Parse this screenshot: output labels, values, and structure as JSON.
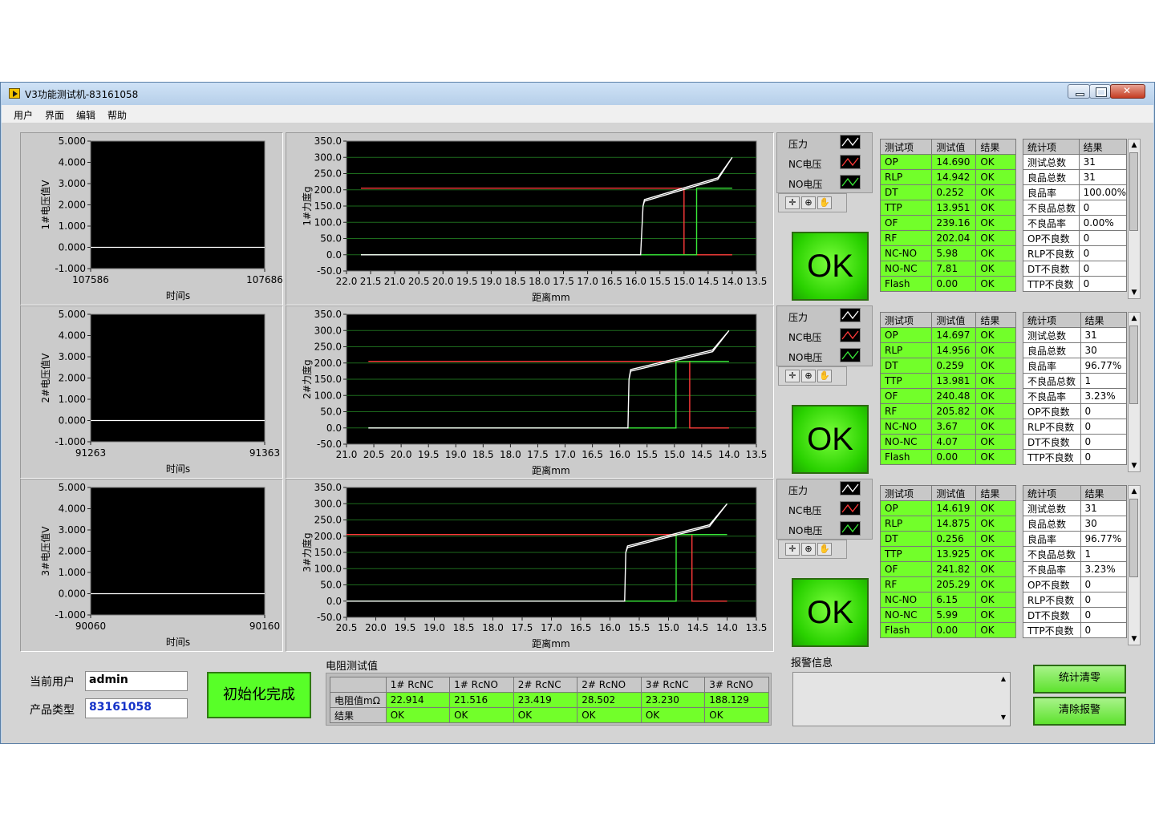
{
  "window": {
    "title": "V3功能测试机-83161058"
  },
  "menu": [
    "用户",
    "界面",
    "编辑",
    "帮助"
  ],
  "colors": {
    "ok_green": "#72ff2a",
    "force_white": "#ffffff",
    "nc_red": "#ff3a3a",
    "no_green": "#38e838"
  },
  "stations": [
    {
      "voltage_chart": {
        "ylabel": "1#电压值V",
        "xlabel": "时间s",
        "yticks": [
          "5.000",
          "4.000",
          "3.000",
          "2.000",
          "1.000",
          "0.000",
          "-1.000"
        ],
        "xticks": [
          "107586",
          "107686"
        ]
      },
      "force_chart": {
        "ylabel": "1#力度g",
        "xlabel": "距离mm",
        "yticks": [
          "350.0",
          "300.0",
          "250.0",
          "200.0",
          "150.0",
          "100.0",
          "50.0",
          "0.0",
          "-50.0"
        ],
        "xticks": [
          "22.0",
          "21.5",
          "21.0",
          "20.5",
          "20.0",
          "19.5",
          "19.0",
          "18.5",
          "18.0",
          "17.5",
          "17.0",
          "16.5",
          "16.0",
          "15.5",
          "15.0",
          "14.5",
          "14.0",
          "13.5"
        ]
      },
      "legend": [
        "压力",
        "NC电压",
        "NO电压"
      ],
      "result": "OK",
      "test_table": {
        "headers": [
          "测试项",
          "测试值",
          "结果"
        ],
        "rows": [
          [
            "OP",
            "14.690",
            "OK"
          ],
          [
            "RLP",
            "14.942",
            "OK"
          ],
          [
            "DT",
            "0.252",
            "OK"
          ],
          [
            "TTP",
            "13.951",
            "OK"
          ],
          [
            "OF",
            "239.16",
            "OK"
          ],
          [
            "RF",
            "202.04",
            "OK"
          ],
          [
            "NC-NO",
            "5.98",
            "OK"
          ],
          [
            "NO-NC",
            "7.81",
            "OK"
          ],
          [
            "Flash",
            "0.00",
            "OK"
          ]
        ]
      },
      "stat_table": {
        "headers": [
          "统计项",
          "结果"
        ],
        "rows": [
          [
            "测试总数",
            "31"
          ],
          [
            "良品总数",
            "31"
          ],
          [
            "良品率",
            "100.00%"
          ],
          [
            "不良品总数",
            "0"
          ],
          [
            "不良品率",
            "0.00%"
          ],
          [
            "OP不良数",
            "0"
          ],
          [
            "RLP不良数",
            "0"
          ],
          [
            "DT不良数",
            "0"
          ],
          [
            "TTP不良数",
            "0"
          ]
        ]
      }
    },
    {
      "voltage_chart": {
        "ylabel": "2#电压值V",
        "xlabel": "时间s",
        "yticks": [
          "5.000",
          "4.000",
          "3.000",
          "2.000",
          "1.000",
          "0.000",
          "-1.000"
        ],
        "xticks": [
          "91263",
          "91363"
        ]
      },
      "force_chart": {
        "ylabel": "2#力度g",
        "xlabel": "距离mm",
        "yticks": [
          "350.0",
          "300.0",
          "250.0",
          "200.0",
          "150.0",
          "100.0",
          "50.0",
          "0.0",
          "-50.0"
        ],
        "xticks": [
          "21.0",
          "20.5",
          "20.0",
          "19.5",
          "19.0",
          "18.5",
          "18.0",
          "17.5",
          "17.0",
          "16.5",
          "16.0",
          "15.5",
          "15.0",
          "14.5",
          "14.0",
          "13.5"
        ]
      },
      "legend": [
        "压力",
        "NC电压",
        "NO电压"
      ],
      "result": "OK",
      "test_table": {
        "headers": [
          "测试项",
          "测试值",
          "结果"
        ],
        "rows": [
          [
            "OP",
            "14.697",
            "OK"
          ],
          [
            "RLP",
            "14.956",
            "OK"
          ],
          [
            "DT",
            "0.259",
            "OK"
          ],
          [
            "TTP",
            "13.981",
            "OK"
          ],
          [
            "OF",
            "240.48",
            "OK"
          ],
          [
            "RF",
            "205.82",
            "OK"
          ],
          [
            "NC-NO",
            "3.67",
            "OK"
          ],
          [
            "NO-NC",
            "4.07",
            "OK"
          ],
          [
            "Flash",
            "0.00",
            "OK"
          ]
        ]
      },
      "stat_table": {
        "headers": [
          "统计项",
          "结果"
        ],
        "rows": [
          [
            "测试总数",
            "31"
          ],
          [
            "良品总数",
            "30"
          ],
          [
            "良品率",
            "96.77%"
          ],
          [
            "不良品总数",
            "1"
          ],
          [
            "不良品率",
            "3.23%"
          ],
          [
            "OP不良数",
            "0"
          ],
          [
            "RLP不良数",
            "0"
          ],
          [
            "DT不良数",
            "0"
          ],
          [
            "TTP不良数",
            "0"
          ]
        ]
      }
    },
    {
      "voltage_chart": {
        "ylabel": "3#电压值V",
        "xlabel": "时间s",
        "yticks": [
          "5.000",
          "4.000",
          "3.000",
          "2.000",
          "1.000",
          "0.000",
          "-1.000"
        ],
        "xticks": [
          "90060",
          "90160"
        ]
      },
      "force_chart": {
        "ylabel": "3#力度g",
        "xlabel": "距离mm",
        "yticks": [
          "350.0",
          "300.0",
          "250.0",
          "200.0",
          "150.0",
          "100.0",
          "50.0",
          "0.0",
          "-50.0"
        ],
        "xticks": [
          "20.5",
          "20.0",
          "19.5",
          "19.0",
          "18.5",
          "18.0",
          "17.5",
          "17.0",
          "16.5",
          "16.0",
          "15.5",
          "15.0",
          "14.5",
          "14.0",
          "13.5"
        ]
      },
      "legend": [
        "压力",
        "NC电压",
        "NO电压"
      ],
      "result": "OK",
      "test_table": {
        "headers": [
          "测试项",
          "测试值",
          "结果"
        ],
        "rows": [
          [
            "OP",
            "14.619",
            "OK"
          ],
          [
            "RLP",
            "14.875",
            "OK"
          ],
          [
            "DT",
            "0.256",
            "OK"
          ],
          [
            "TTP",
            "13.925",
            "OK"
          ],
          [
            "OF",
            "241.82",
            "OK"
          ],
          [
            "RF",
            "205.29",
            "OK"
          ],
          [
            "NC-NO",
            "6.15",
            "OK"
          ],
          [
            "NO-NC",
            "5.99",
            "OK"
          ],
          [
            "Flash",
            "0.00",
            "OK"
          ]
        ]
      },
      "stat_table": {
        "headers": [
          "统计项",
          "结果"
        ],
        "rows": [
          [
            "测试总数",
            "31"
          ],
          [
            "良品总数",
            "30"
          ],
          [
            "良品率",
            "96.77%"
          ],
          [
            "不良品总数",
            "1"
          ],
          [
            "不良品率",
            "3.23%"
          ],
          [
            "OP不良数",
            "0"
          ],
          [
            "RLP不良数",
            "0"
          ],
          [
            "DT不良数",
            "0"
          ],
          [
            "TTP不良数",
            "0"
          ]
        ]
      }
    }
  ],
  "bottom": {
    "current_user_label": "当前用户",
    "current_user": "admin",
    "product_type_label": "产品类型",
    "product_type": "83161058",
    "init_button": "初始化完成",
    "resistance_title": "电阻测试值",
    "resistance_headers": [
      "",
      "1# RcNC",
      "1# RcNO",
      "2# RcNC",
      "2# RcNO",
      "3# RcNC",
      "3# RcNO"
    ],
    "resistance_rows": [
      [
        "电阻值mΩ",
        "22.914",
        "21.516",
        "23.419",
        "28.502",
        "23.230",
        "188.129"
      ],
      [
        "结果",
        "OK",
        "OK",
        "OK",
        "OK",
        "OK",
        "OK"
      ]
    ],
    "alarm_label": "报警信息",
    "alarm_text": "",
    "stat_clear_button": "统计清零",
    "clear_alarm_button": "清除报警"
  },
  "chart_data": [
    {
      "type": "line",
      "title": "",
      "xlabel": "时间s",
      "ylabel": "1#电压值V",
      "xlim": [
        107586,
        107686
      ],
      "ylim": [
        -1,
        5
      ],
      "grid": false,
      "series": [
        {
          "x": [
            107586,
            107686
          ],
          "y": [
            0.0,
            0.0
          ]
        }
      ]
    },
    {
      "type": "line",
      "title": "",
      "xlabel": "距离mm",
      "ylabel": "1#力度g",
      "xlim": [
        22.0,
        13.5
      ],
      "ylim": [
        -50,
        350
      ],
      "grid": true,
      "x_reversed": true,
      "series": [
        {
          "name": "压力",
          "x": [
            21.7,
            16.5,
            15.9,
            15.85,
            15.82,
            14.3,
            14.0,
            14.3,
            15.82,
            15.85,
            15.9,
            16.5,
            21.7
          ],
          "y": [
            0,
            0,
            0,
            150,
            165,
            232,
            300,
            237,
            170,
            150,
            0,
            0,
            0
          ]
        },
        {
          "name": "NC电压",
          "x": [
            21.7,
            15.0,
            15.0,
            14.0
          ],
          "y": [
            205,
            205,
            0,
            0
          ]
        },
        {
          "name": "NO电压",
          "x": [
            21.7,
            14.74,
            14.74,
            14.0
          ],
          "y": [
            0,
            0,
            205,
            205
          ]
        }
      ]
    },
    {
      "type": "line",
      "title": "",
      "xlabel": "时间s",
      "ylabel": "2#电压值V",
      "xlim": [
        91263,
        91363
      ],
      "ylim": [
        -1,
        5
      ],
      "grid": false,
      "series": [
        {
          "x": [
            91263,
            91363
          ],
          "y": [
            0.0,
            0.0
          ]
        }
      ]
    },
    {
      "type": "line",
      "title": "",
      "xlabel": "距离mm",
      "ylabel": "2#力度g",
      "xlim": [
        21.0,
        13.5
      ],
      "ylim": [
        -50,
        350
      ],
      "grid": true,
      "x_reversed": true,
      "series": [
        {
          "name": "压力",
          "x": [
            20.6,
            16.2,
            15.85,
            15.83,
            15.8,
            14.3,
            14.0,
            14.3,
            15.8,
            15.83,
            15.85,
            16.2,
            20.6
          ],
          "y": [
            0,
            0,
            0,
            150,
            175,
            235,
            300,
            240,
            180,
            150,
            0,
            0,
            0
          ]
        },
        {
          "name": "NC电压",
          "x": [
            20.6,
            14.72,
            14.72,
            14.0
          ],
          "y": [
            205,
            205,
            0,
            0
          ]
        },
        {
          "name": "NO电压",
          "x": [
            20.6,
            14.97,
            14.97,
            14.0
          ],
          "y": [
            0,
            0,
            205,
            205
          ]
        }
      ]
    },
    {
      "type": "line",
      "title": "",
      "xlabel": "时间s",
      "ylabel": "3#电压值V",
      "xlim": [
        90060,
        90160
      ],
      "ylim": [
        -1,
        5
      ],
      "grid": false,
      "series": [
        {
          "x": [
            90060,
            90160
          ],
          "y": [
            0.0,
            0.0
          ]
        }
      ]
    },
    {
      "type": "line",
      "title": "",
      "xlabel": "距离mm",
      "ylabel": "3#力度g",
      "xlim": [
        20.5,
        13.5
      ],
      "ylim": [
        -50,
        350
      ],
      "grid": true,
      "x_reversed": true,
      "series": [
        {
          "name": "压力",
          "x": [
            20.5,
            16.2,
            15.75,
            15.73,
            15.7,
            14.3,
            14.0,
            14.3,
            15.7,
            15.73,
            15.75,
            16.2,
            20.5
          ],
          "y": [
            0,
            0,
            0,
            150,
            165,
            230,
            300,
            235,
            170,
            150,
            0,
            0,
            0
          ]
        },
        {
          "name": "NC电压",
          "x": [
            20.5,
            14.6,
            14.6,
            14.0
          ],
          "y": [
            205,
            205,
            0,
            0
          ]
        },
        {
          "name": "NO电压",
          "x": [
            20.5,
            14.87,
            14.87,
            14.0
          ],
          "y": [
            0,
            0,
            205,
            205
          ]
        }
      ]
    }
  ]
}
